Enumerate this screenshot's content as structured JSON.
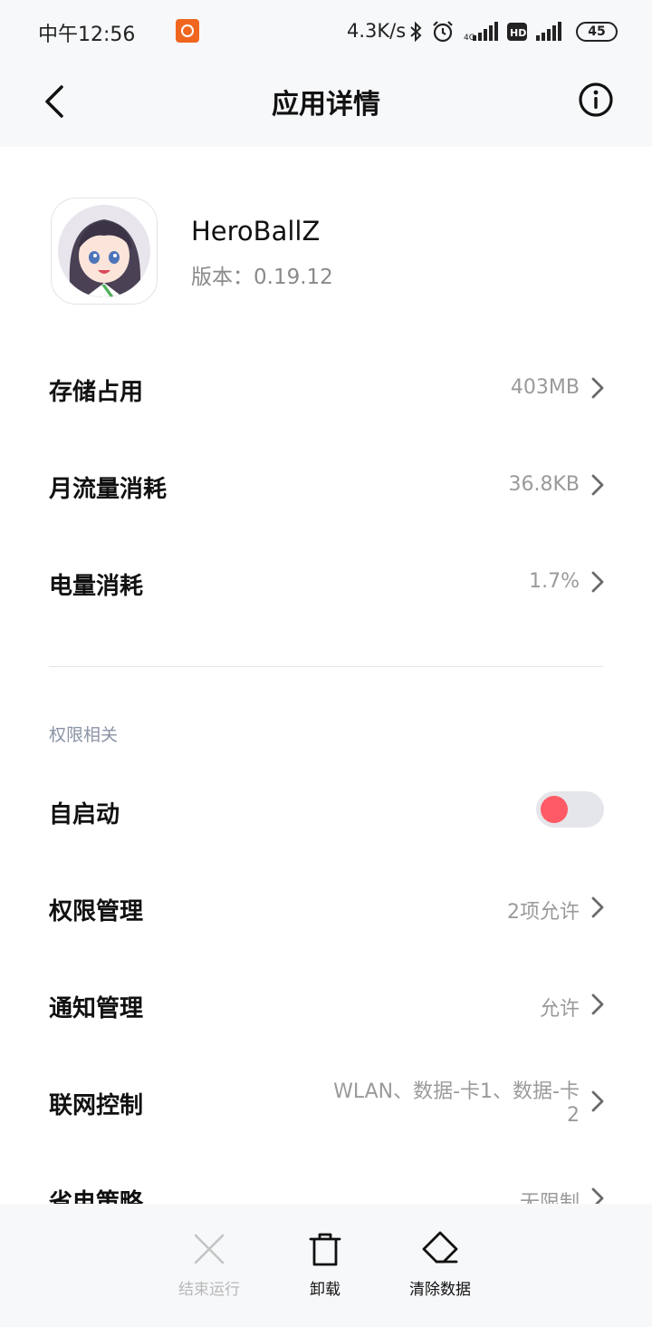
{
  "status_bar": {
    "time": "中午12:56",
    "network_speed": "4.3K/s",
    "battery": "45",
    "icons": [
      "app-notification-icon",
      "bluetooth-icon",
      "alarm-icon",
      "signal-icon",
      "hd-icon",
      "signal-icon"
    ]
  },
  "header": {
    "title": "应用详情",
    "back_icon": "back-chevron-icon",
    "info_icon": "info-icon"
  },
  "app": {
    "name": "HeroBallZ",
    "version_label": "版本：0.19.12"
  },
  "usage": [
    {
      "label": "存储占用",
      "value": "403MB"
    },
    {
      "label": "月流量消耗",
      "value": "36.8KB"
    },
    {
      "label": "电量消耗",
      "value": "1.7%"
    }
  ],
  "permissions": {
    "section_title": "权限相关",
    "autostart": {
      "label": "自启动",
      "enabled": true
    },
    "items": [
      {
        "label": "权限管理",
        "value": "2项允许"
      },
      {
        "label": "通知管理",
        "value": "允许"
      },
      {
        "label": "联网控制",
        "value_line1": "WLAN、数据-卡1、数据-卡",
        "value_line2": "2"
      },
      {
        "label": "省电策略",
        "value": "无限制"
      }
    ]
  },
  "bottom_actions": [
    {
      "label": "结束运行",
      "icon": "close-icon",
      "enabled": false
    },
    {
      "label": "卸载",
      "icon": "trash-icon",
      "enabled": true
    },
    {
      "label": "清除数据",
      "icon": "eraser-icon",
      "enabled": true
    }
  ],
  "colors": {
    "toggle_knob": "#ff5a65",
    "background_bars": "#f7f8fa",
    "value_text": "#9a9a9a",
    "section_title": "#8a93a5",
    "disabled_action": "#b8b8b8"
  }
}
